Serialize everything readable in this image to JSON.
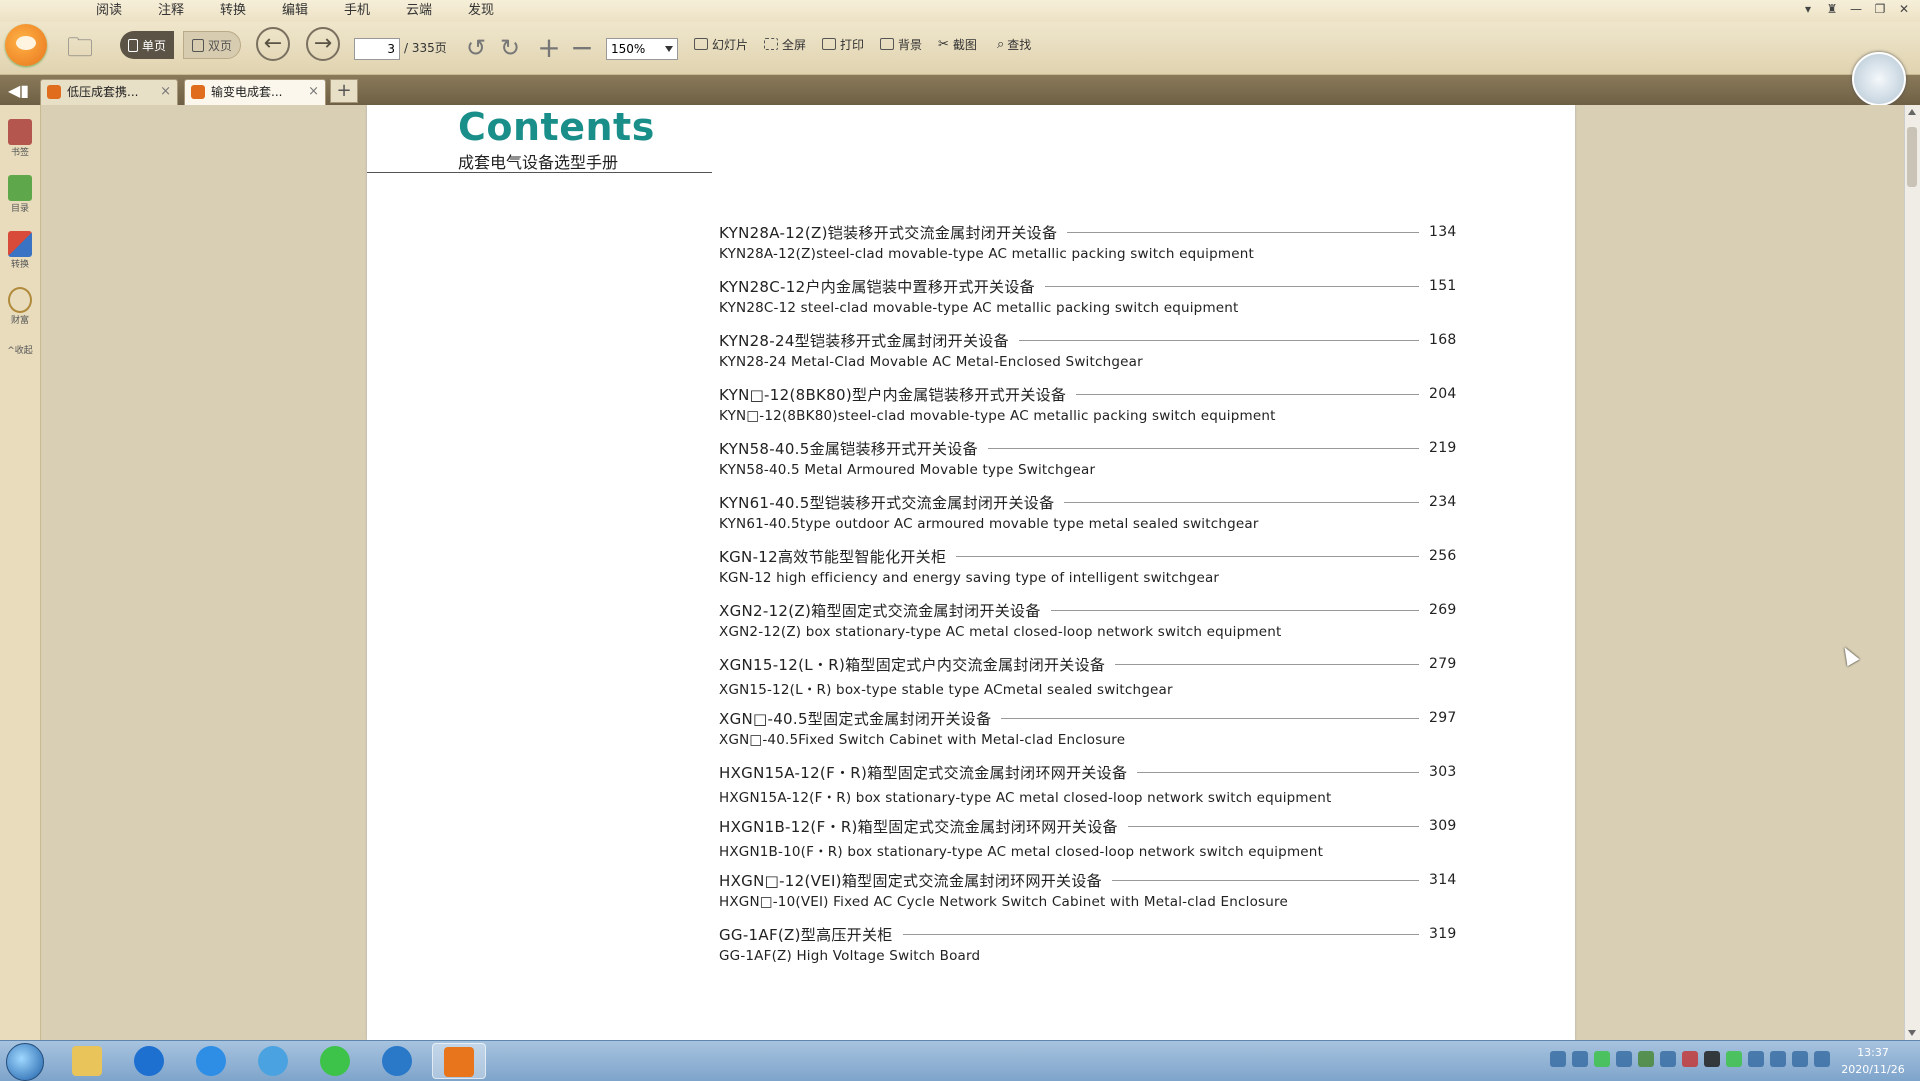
{
  "menu": [
    "阅读",
    "注释",
    "转换",
    "编辑",
    "手机",
    "云端",
    "发现"
  ],
  "toolbar": {
    "single_page": "单页",
    "double_page": "双页",
    "page_current": "3",
    "page_total": "/ 335页",
    "zoom": "150%",
    "slideshow": "幻灯片",
    "fullscreen": "全屏",
    "print": "打印",
    "background": "背景",
    "screenshot": "截图",
    "search": "查找"
  },
  "tabs": [
    {
      "label": "低压成套携...",
      "close": "×"
    },
    {
      "label": "输变电成套...",
      "close": "×"
    }
  ],
  "tab_add": "+",
  "sidebar": [
    "书签",
    "目录",
    "转换",
    "财富",
    "^收起"
  ],
  "document": {
    "title": "Contents",
    "subtitle": "成套电气设备选型手册",
    "entries": [
      {
        "title": "KYN28A-12(Z)铠装移开式交流金属封闭开关设备",
        "page": "134",
        "english": "KYN28A-12(Z)steel-clad movable-type AC metallic packing switch equipment"
      },
      {
        "title": "KYN28C-12户内金属铠装中置移开式开关设备",
        "page": "151",
        "english": "KYN28C-12 steel-clad movable-type AC metallic packing switch equipment"
      },
      {
        "title": "KYN28-24型铠装移开式金属封闭开关设备",
        "page": "168",
        "english": "KYN28-24 Metal-Clad Movable AC Metal-Enclosed Switchgear"
      },
      {
        "title": "KYN□-12(8BK80)型户内金属铠装移开式开关设备",
        "page": "204",
        "english": "KYN□-12(8BK80)steel-clad movable-type AC metallic packing switch equipment"
      },
      {
        "title": "KYN58-40.5金属铠装移开式开关设备",
        "page": "219",
        "english": "KYN58-40.5 Metal Armoured Movable type Switchgear"
      },
      {
        "title": "KYN61-40.5型铠装移开式交流金属封闭开关设备",
        "page": "234",
        "english": "KYN61-40.5type outdoor AC armoured movable type metal sealed switchgear"
      },
      {
        "title": "KGN-12高效节能型智能化开关柜",
        "page": "256",
        "english": "KGN-12 high efficiency and energy saving type of intelligent switchgear"
      },
      {
        "title": "XGN2-12(Z)箱型固定式交流金属封闭开关设备",
        "page": "269",
        "english": "XGN2-12(Z) box   stationary-type AC metal closed-loop network switch equipment"
      },
      {
        "title": "XGN15-12(L・R)箱型固定式户内交流金属封闭开关设备",
        "page": "279",
        "english": "XGN15-12(L・R) box-type stable type ACmetal sealed switchgear"
      },
      {
        "title": "XGN□-40.5型固定式金属封闭开关设备",
        "page": "297",
        "english": "XGN□-40.5Fixed Switch Cabinet with Metal-clad Enclosure"
      },
      {
        "title": "HXGN15A-12(F・R)箱型固定式交流金属封闭环网开关设备",
        "page": "303",
        "english": "HXGN15A-12(F・R) box stationary-type AC metal closed-loop network switch equipment"
      },
      {
        "title": "HXGN1B-12(F・R)箱型固定式交流金属封闭环网开关设备",
        "page": "309",
        "english": "HXGN1B-10(F・R) box stationary-type AC metal closed-loop network switch equipment"
      },
      {
        "title": "HXGN□-12(VEI)箱型固定式交流金属封闭环网开关设备",
        "page": "314",
        "english": "HXGN□-10(VEI) Fixed AC Cycle Network Switch Cabinet with Metal-clad Enclosure"
      },
      {
        "title": "GG-1AF(Z)型高压开关柜",
        "page": "319",
        "english": "GG-1AF(Z) High Voltage Switch Board"
      }
    ]
  },
  "clock": {
    "time": "13:37",
    "date": "2020/11/26"
  }
}
